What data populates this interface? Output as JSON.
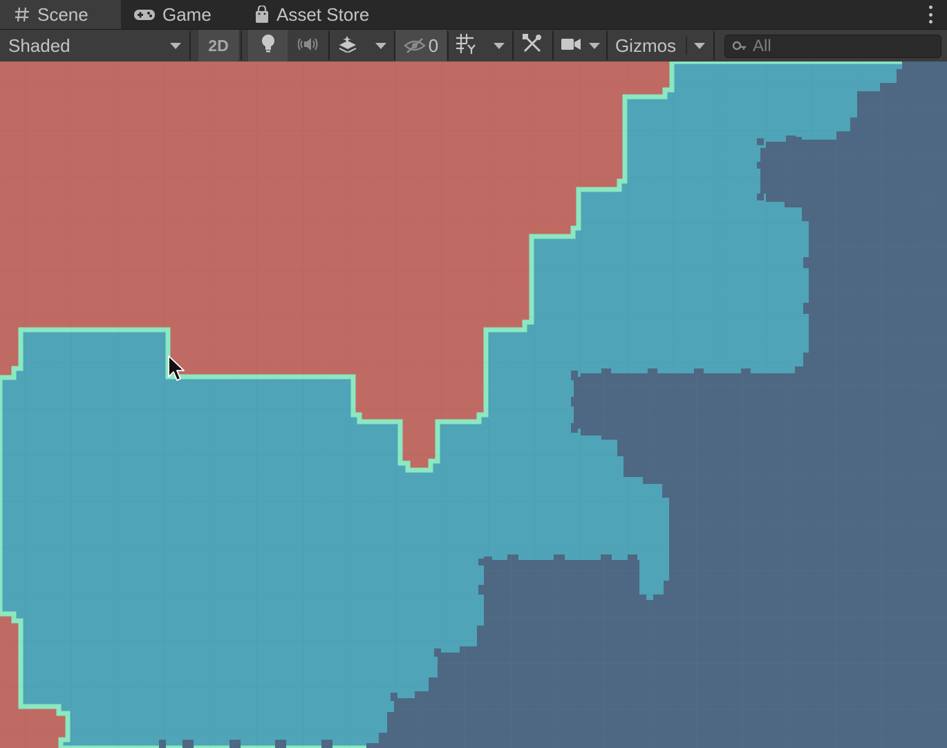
{
  "window_tabs": [
    {
      "label": "Scene",
      "icon": "grid-hash-icon",
      "active": true
    },
    {
      "label": "Game",
      "icon": "gamepad-icon",
      "active": false
    },
    {
      "label": "Asset Store",
      "icon": "shopping-bag-icon",
      "active": false
    }
  ],
  "toolbar": {
    "draw_mode": "Shaded",
    "mode_2d_label": "2D",
    "hidden_count": "0",
    "gizmos_label": "Gizmos",
    "search_placeholder": "All"
  },
  "scene": {
    "description_colors": {
      "outer_terrain": "#bf6a63",
      "mid_terrain": "#4fa4b8",
      "inner_terrain": "#4e6883",
      "outline": "#8be8c0"
    }
  }
}
